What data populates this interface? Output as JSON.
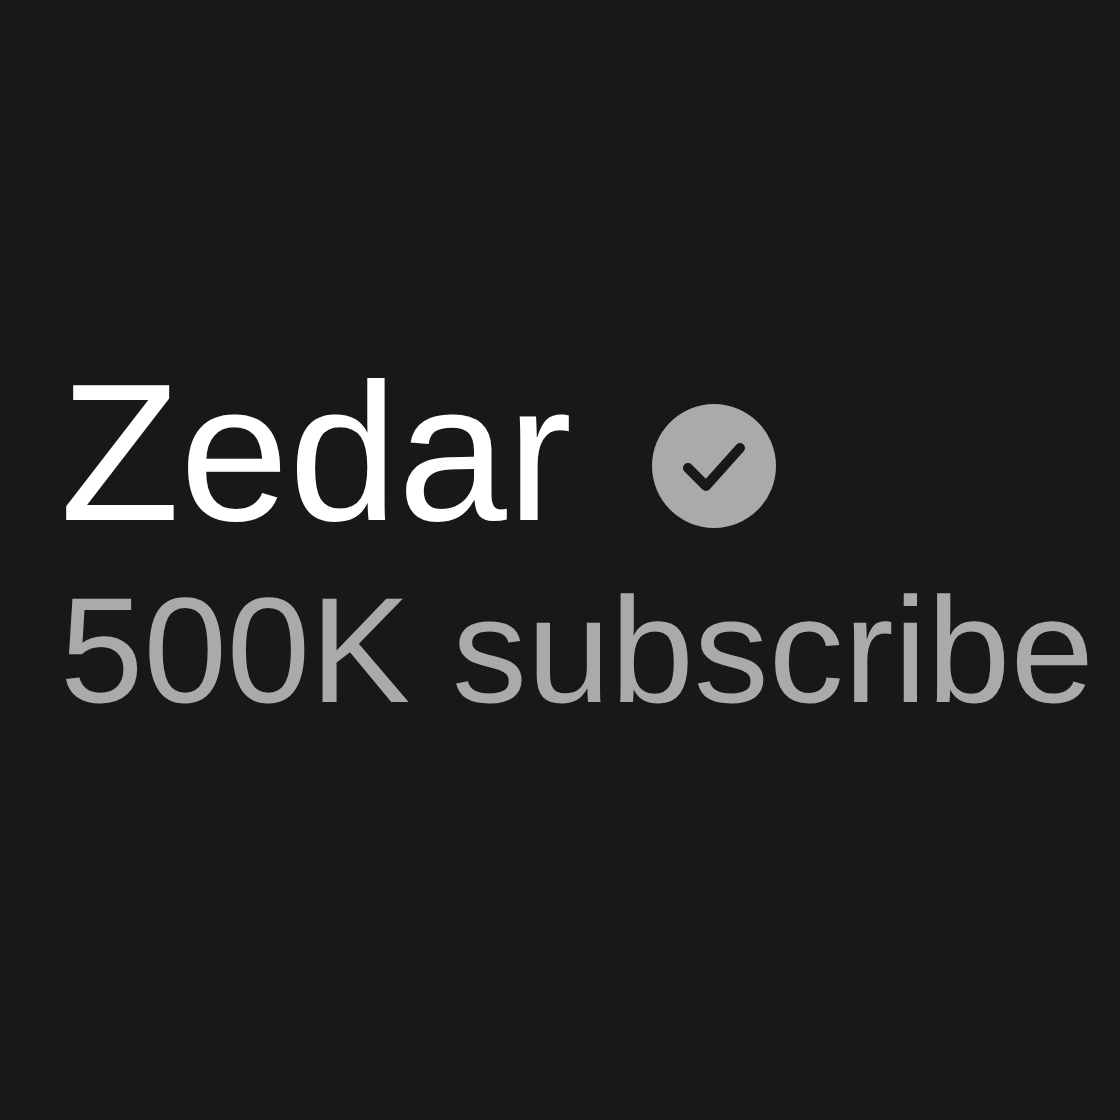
{
  "channel": {
    "name": "Zedar",
    "verified": true,
    "subscribers": "500K subscribe"
  }
}
